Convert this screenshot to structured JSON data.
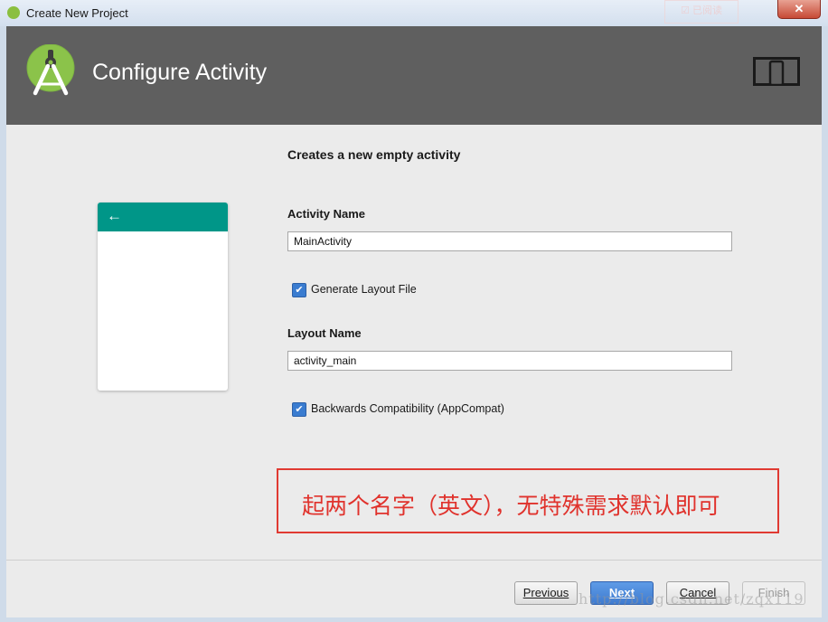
{
  "window": {
    "title": "Create New Project",
    "close_label": "✕",
    "watermark_tag": "☑ 已阅读"
  },
  "header": {
    "title": "Configure Activity",
    "background_color": "#5f5f5f",
    "logo_icon": "android-studio-logo",
    "device_icon": "phone-tablet-icon"
  },
  "preview": {
    "toolbar_color": "#009688",
    "back_icon": "←"
  },
  "form": {
    "heading": "Creates a new empty activity",
    "activity_name_label": "Activity Name",
    "activity_name_value": "MainActivity",
    "generate_layout_label": "Generate Layout File",
    "generate_layout_checked": true,
    "layout_name_label": "Layout Name",
    "layout_name_value": "activity_main",
    "backwards_compat_label": "Backwards Compatibility (AppCompat)",
    "backwards_compat_checked": true,
    "check_mark": "✔"
  },
  "annotation": {
    "text": "起两个名字（英文），无特殊需求默认即可",
    "color": "#e03a32"
  },
  "footer": {
    "previous": "Previous",
    "next": "Next",
    "cancel": "Cancel",
    "finish": "Finish"
  },
  "watermark": "http://blog.csdn.net/zqx119"
}
